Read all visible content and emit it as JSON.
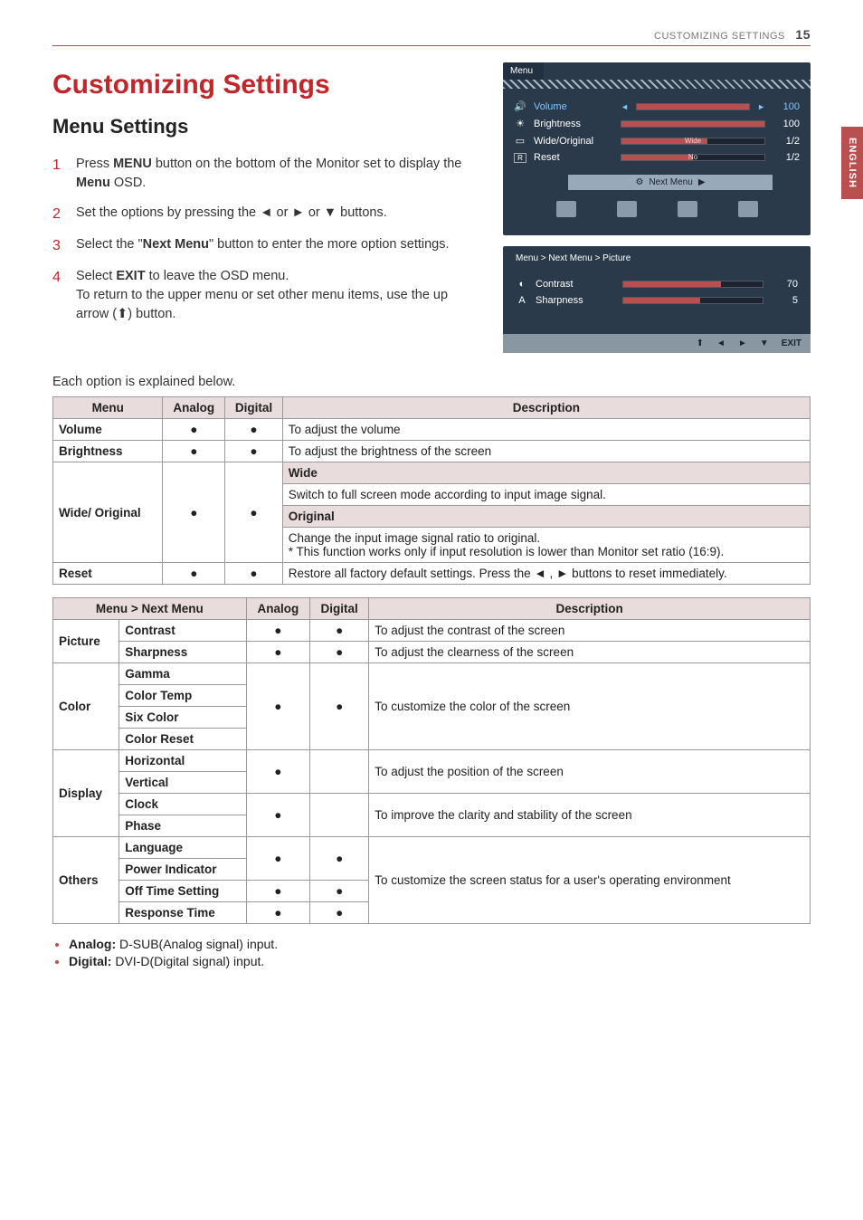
{
  "header": {
    "section": "CUSTOMIZING SETTINGS",
    "page": "15"
  },
  "sidetab": "ENGLISH",
  "title": "Customizing Settings",
  "subtitle": "Menu Settings",
  "steps": [
    {
      "num": "1",
      "text": "Press MENU button on the bottom of the Monitor set to display the Menu OSD."
    },
    {
      "num": "2",
      "text": "Set the options by pressing the ◄ or ► or ▼ buttons."
    },
    {
      "num": "3",
      "text": "Select the \"Next Menu\" button to enter the more option settings."
    },
    {
      "num": "4",
      "text": "Select EXIT to leave the OSD menu. To return to the upper menu or set other menu items, use the up arrow (⬆) button."
    }
  ],
  "osd1": {
    "tab": "Menu",
    "rows": [
      {
        "icon": "🔊",
        "label": "Volume",
        "val": "100",
        "fill": 100
      },
      {
        "icon": "☀",
        "label": "Brightness",
        "val": "100",
        "fill": 100
      },
      {
        "icon": "▭",
        "label": "Wide/Original",
        "bartxt": "Wide",
        "val": "1/2",
        "fill": 60
      },
      {
        "icon": "R",
        "label": "Reset",
        "bartxt": "No",
        "val": "1/2",
        "fill": 50
      }
    ],
    "nextmenu": "Next Menu"
  },
  "osd2": {
    "crumb": "Menu  >  Next Menu  >  Picture",
    "rows": [
      {
        "icon": "◐",
        "label": "Contrast",
        "val": "70",
        "fill": 70
      },
      {
        "icon": "A",
        "label": "Sharpness",
        "val": "5",
        "fill": 55
      }
    ],
    "nav": [
      "⬆",
      "◄",
      "►",
      "▼",
      "EXIT"
    ]
  },
  "intro": "Each option is explained below.",
  "t1": {
    "headers": [
      "Menu",
      "Analog",
      "Digital",
      "Description"
    ],
    "volume": {
      "lbl": "Volume",
      "desc": "To adjust the volume"
    },
    "brightness": {
      "lbl": "Brightness",
      "desc": "To adjust the brightness of the screen"
    },
    "wideorig": {
      "lbl": "Wide/ Original",
      "widehdr": "Wide",
      "widedesc": "Switch to full screen mode according to input image signal.",
      "orighdr": "Original",
      "origdesc": "Change the input image signal ratio to original.\n* This function works only if input resolution is lower than Monitor set ratio (16:9)."
    },
    "reset": {
      "lbl": "Reset",
      "desc": "Restore all factory default settings. Press the ◄ , ► buttons to reset immediately."
    }
  },
  "t2": {
    "headers": [
      "Menu > Next Menu",
      "Analog",
      "Digital",
      "Description"
    ],
    "picture": {
      "cat": "Picture",
      "contrast": {
        "lbl": "Contrast",
        "desc": "To adjust the contrast of the screen"
      },
      "sharpness": {
        "lbl": "Sharpness",
        "desc": "To adjust the clearness of the screen"
      }
    },
    "color": {
      "cat": "Color",
      "items": [
        "Gamma",
        "Color Temp",
        "Six Color",
        "Color Reset"
      ],
      "desc": "To customize the color of the screen"
    },
    "display": {
      "cat": "Display",
      "pos": {
        "items": [
          "Horizontal",
          "Vertical"
        ],
        "desc": "To adjust the position of the screen"
      },
      "clk": {
        "items": [
          "Clock",
          "Phase"
        ],
        "desc": "To improve the clarity and stability of the screen"
      }
    },
    "others": {
      "cat": "Others",
      "items": [
        "Language",
        "Power Indicator",
        "Off Time Setting",
        "Response Time"
      ],
      "desc": "To customize the screen status for a user's operating environment"
    }
  },
  "notes": [
    {
      "lbl": "Analog:",
      "txt": " D-SUB(Analog signal) input."
    },
    {
      "lbl": "Digital:",
      "txt": " DVI-D(Digital signal) input."
    }
  ]
}
